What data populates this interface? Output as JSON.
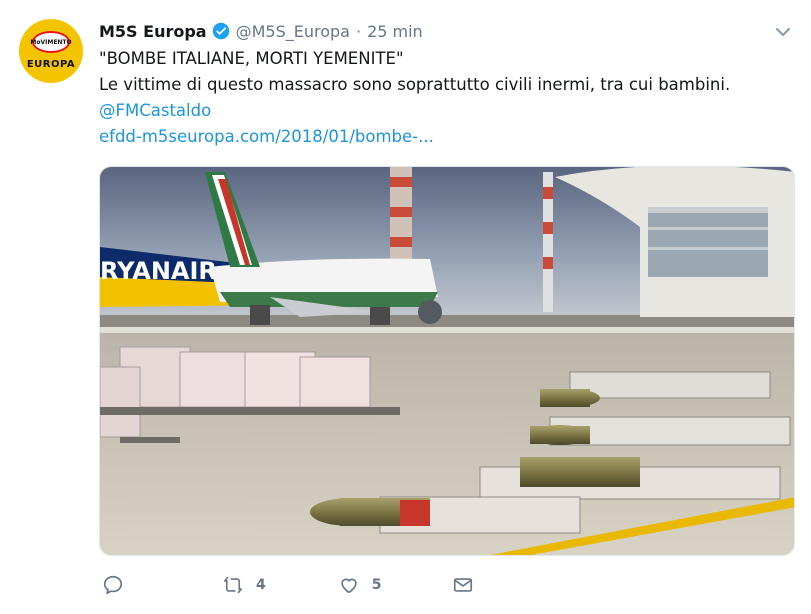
{
  "tweet": {
    "author_name": "M5S Europa",
    "handle": "@M5S_Europa",
    "separator": "·",
    "time": "25 min",
    "avatar_badge": "MoVIMENTO",
    "avatar_text": "EUROPA",
    "line1": "\"BOMBE ITALIANE, MORTI YEMENITE\"",
    "line2": "Le vittime di questo massacro sono soprattutto civili inermi, tra cui bambini.",
    "mention": "@FMCastaldo",
    "url": "efdd-m5seuropa.com/2018/01/bombe-...",
    "media_tail_text": "RYANAIR"
  },
  "actions": {
    "reply_count": "",
    "retweet_count": "4",
    "like_count": "5"
  },
  "colors": {
    "link": "#1b95e0",
    "muted": "#657786",
    "verified": "#1da1f2",
    "avatar_bg": "#f5c400"
  },
  "icons": [
    "verified-badge-icon",
    "caret-down-icon",
    "reply-icon",
    "retweet-icon",
    "like-icon",
    "direct-message-icon"
  ]
}
